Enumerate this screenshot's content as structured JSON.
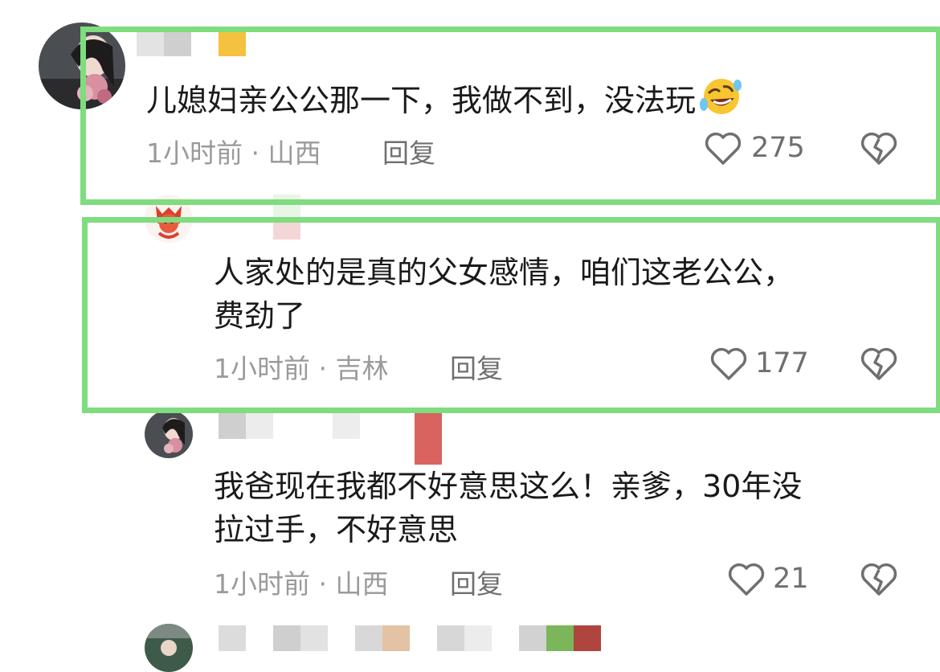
{
  "colors": {
    "highlight": "#7fdc7f",
    "text": "#1a1a1a",
    "meta": "#9a9a9a"
  },
  "comments": [
    {
      "text": "儿媳妇亲公公那一下，我做不到，没法玩",
      "emoji": "rolling-on-floor-laughing-emoji",
      "time_location": "1小时前 · 山西",
      "reply_label": "回复",
      "likes": "275",
      "avatar": "user-avatar-icon"
    },
    {
      "text_line1": "人家处的是真的父女感情，咱们这老公公，",
      "text_line2": "费劲了",
      "time_location": "1小时前 · 吉林",
      "reply_label": "回复",
      "likes": "177",
      "avatar": "user-avatar-icon"
    },
    {
      "text_line1": "我爸现在我都不好意思这么！亲爹，30年没",
      "text_line2": "拉过手，不好意思",
      "time_location": "1小时前 · 山西",
      "reply_label": "回复",
      "likes": "21",
      "avatar": "user-avatar-icon"
    }
  ]
}
